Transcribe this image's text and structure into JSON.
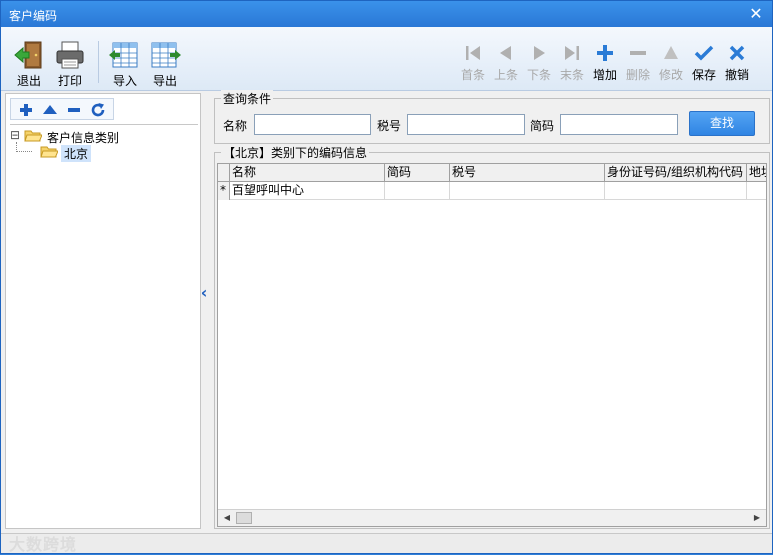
{
  "window": {
    "title": "客户编码",
    "close_glyph": "✕"
  },
  "toolbar": {
    "exit_label": "退出",
    "print_label": "打印",
    "import_label": "导入",
    "export_label": "导出",
    "first_label": "首条",
    "prev_label": "上条",
    "next_label": "下条",
    "last_label": "末条",
    "add_label": "增加",
    "delete_label": "删除",
    "edit_label": "修改",
    "save_label": "保存",
    "cancel_label": "撤销"
  },
  "tree": {
    "root_label": "客户信息类别",
    "root_toggle": "⊟",
    "child_label": "北京"
  },
  "query": {
    "caption": "查询条件",
    "name_label": "名称",
    "name_value": "",
    "tax_label": "税号",
    "tax_value": "",
    "code_label": "简码",
    "code_value": "",
    "search_label": "查找"
  },
  "grid": {
    "caption": "【北京】类别下的编码信息",
    "columns": [
      "名称",
      "简码",
      "税号",
      "身份证号码/组织机构代码",
      "地址"
    ],
    "visible_columns": [
      "名称",
      "简码",
      "税号",
      "身份证号码/组织机构代码",
      "地址"
    ],
    "rows": [
      {
        "marker": "*",
        "cells": [
          "百望呼叫中心",
          "",
          "",
          "",
          ""
        ]
      }
    ]
  },
  "watermark": "大数跨境",
  "colors": {
    "titlebar": "#2a78d6",
    "accent": "#1f5fbf",
    "search_button": "#2f84e3"
  }
}
